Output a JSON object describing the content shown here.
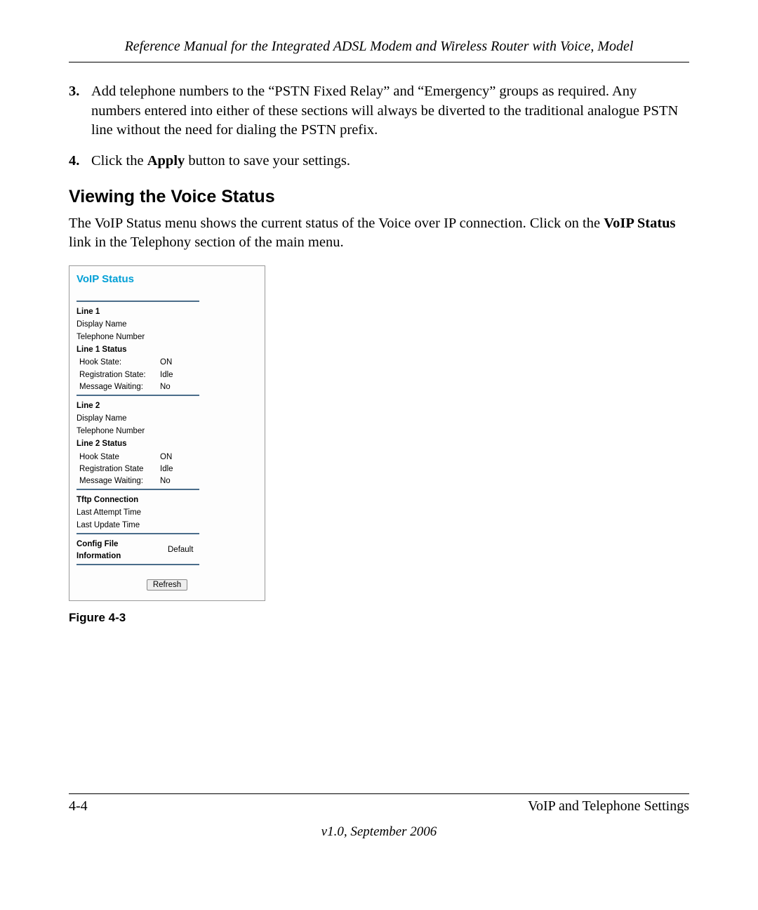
{
  "header": {
    "title": "Reference Manual for the Integrated ADSL Modem and Wireless Router with Voice, Model"
  },
  "list": {
    "item3_num": "3.",
    "item3_text": "Add telephone numbers to the “PSTN Fixed Relay” and “Emergency” groups as required. Any numbers entered into either of these sections will always be diverted to the traditional analogue PSTN line without the need for dialing the PSTN prefix.",
    "item4_num": "4.",
    "item4_pre": "Click the ",
    "item4_bold": "Apply",
    "item4_post": " button to save your settings."
  },
  "section": {
    "heading": "Viewing the Voice Status",
    "para_pre": "The VoIP Status menu shows the current status of the Voice over IP connection. Click on the ",
    "para_bold1": "VoIP Status",
    "para_post": " link in the Telephony section of the main menu."
  },
  "voip": {
    "title": "VoIP Status",
    "line1": {
      "heading": "Line 1",
      "display_name_label": "Display Name",
      "telephone_label": "Telephone Number",
      "status_heading": "Line 1 Status",
      "hook_label": "Hook State:",
      "hook_value": "ON",
      "reg_label": "Registration State:",
      "reg_value": "Idle",
      "msg_label": "Message Waiting:",
      "msg_value": "No"
    },
    "line2": {
      "heading": "Line 2",
      "display_name_label": "Display Name",
      "telephone_label": "Telephone Number",
      "status_heading": "Line 2 Status",
      "hook_label": "Hook State",
      "hook_value": "ON",
      "reg_label": "Registration State",
      "reg_value": "Idle",
      "msg_label": "Message Waiting:",
      "msg_value": "No"
    },
    "tftp": {
      "heading": "Tftp Connection",
      "last_attempt": "Last Attempt Time",
      "last_update": "Last Update Time"
    },
    "config": {
      "label1": "Config File",
      "label2": "Information",
      "value": "Default"
    },
    "refresh": "Refresh"
  },
  "figure_caption": "Figure 4-3",
  "footer": {
    "page": "4-4",
    "section": "VoIP and Telephone Settings",
    "version": "v1.0, September 2006"
  }
}
